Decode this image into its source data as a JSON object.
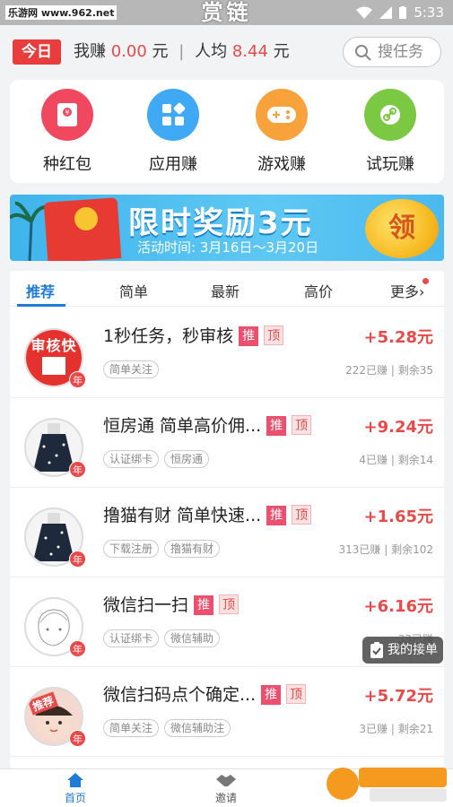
{
  "status_bar": {
    "watermark": "乐游网 www.962.net",
    "app_title": "赏链",
    "time": "5:33"
  },
  "earnings": {
    "today_badge": "今日",
    "my_earn_label": "我赚",
    "my_earn_value": "0.00",
    "currency": "元",
    "avg_label": "人均",
    "avg_value": "8.44",
    "search_label": "搜任务"
  },
  "categories": [
    {
      "label": "种红包",
      "icon": "red-packet-icon",
      "color": "#f0495f"
    },
    {
      "label": "应用赚",
      "icon": "apps-icon",
      "color": "#3fa9f5"
    },
    {
      "label": "游戏赚",
      "icon": "gamepad-icon",
      "color": "#f7a23a"
    },
    {
      "label": "试玩赚",
      "icon": "link-icon",
      "color": "#7bc943"
    }
  ],
  "banner": {
    "title": "限时奖励3元",
    "subtitle": "活动时间: 3月16日～3月20日",
    "button": "领"
  },
  "tabs": [
    {
      "label": "推荐",
      "active": true
    },
    {
      "label": "简单"
    },
    {
      "label": "最新"
    },
    {
      "label": "高价"
    },
    {
      "label": "更多"
    }
  ],
  "tasks": [
    {
      "title": "1秒任务，秒审核",
      "tags": [
        "简单关注"
      ],
      "price": "+5.28元",
      "stats": "222已赚 | 剩余35",
      "avatar_text": "审核快"
    },
    {
      "title": "恒房通 简单高价佣...",
      "tags": [
        "认证绑卡",
        "恒房通"
      ],
      "price": "+9.24元",
      "stats": "4已赚 | 剩余14"
    },
    {
      "title": "撸猫有财 简单快速...",
      "tags": [
        "下载注册",
        "撸猫有财"
      ],
      "price": "+1.65元",
      "stats": "313已赚 | 剩余102"
    },
    {
      "title": "微信扫一扫",
      "tags": [
        "认证绑卡",
        "微信辅助"
      ],
      "price": "+6.16元",
      "stats": "33已赚"
    },
    {
      "title": "微信扫码点个确定...",
      "tags": [
        "简单关注",
        "微信辅助注"
      ],
      "price": "+5.72元",
      "stats": "3已赚 | 剩余21",
      "avatar_text": "推荐"
    }
  ],
  "badges": {
    "tui": "推",
    "ding": "顶",
    "year": "年"
  },
  "floating": {
    "my_orders": "我的接单"
  },
  "bottom_nav": [
    {
      "label": "首页",
      "active": true
    },
    {
      "label": "邀请"
    }
  ],
  "watermark_962": "962.NET 乐游网"
}
